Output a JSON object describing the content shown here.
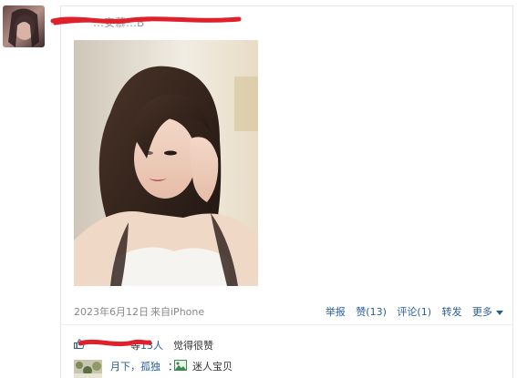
{
  "post": {
    "author_visible": "…安慕…B",
    "date": "2023年6月12日",
    "source": "来自iPhone",
    "actions": {
      "report": "举报",
      "like": "赞(13)",
      "comment": "评论(1)",
      "repost": "转发",
      "more": "更多"
    }
  },
  "likes": {
    "prefix": "等",
    "count": "13人",
    "suffix": "觉得很赞"
  },
  "comment": {
    "user": "月下，孤独",
    "colon": "：",
    "text": "迷人宝贝"
  },
  "colors": {
    "link": "#2b5d99",
    "meta": "#888888",
    "redaction": "#e0202a",
    "border": "#e7e7e7"
  },
  "icons": {
    "like": "thumbs-up-icon",
    "picture": "picture-icon",
    "more": "caret-down-icon"
  }
}
